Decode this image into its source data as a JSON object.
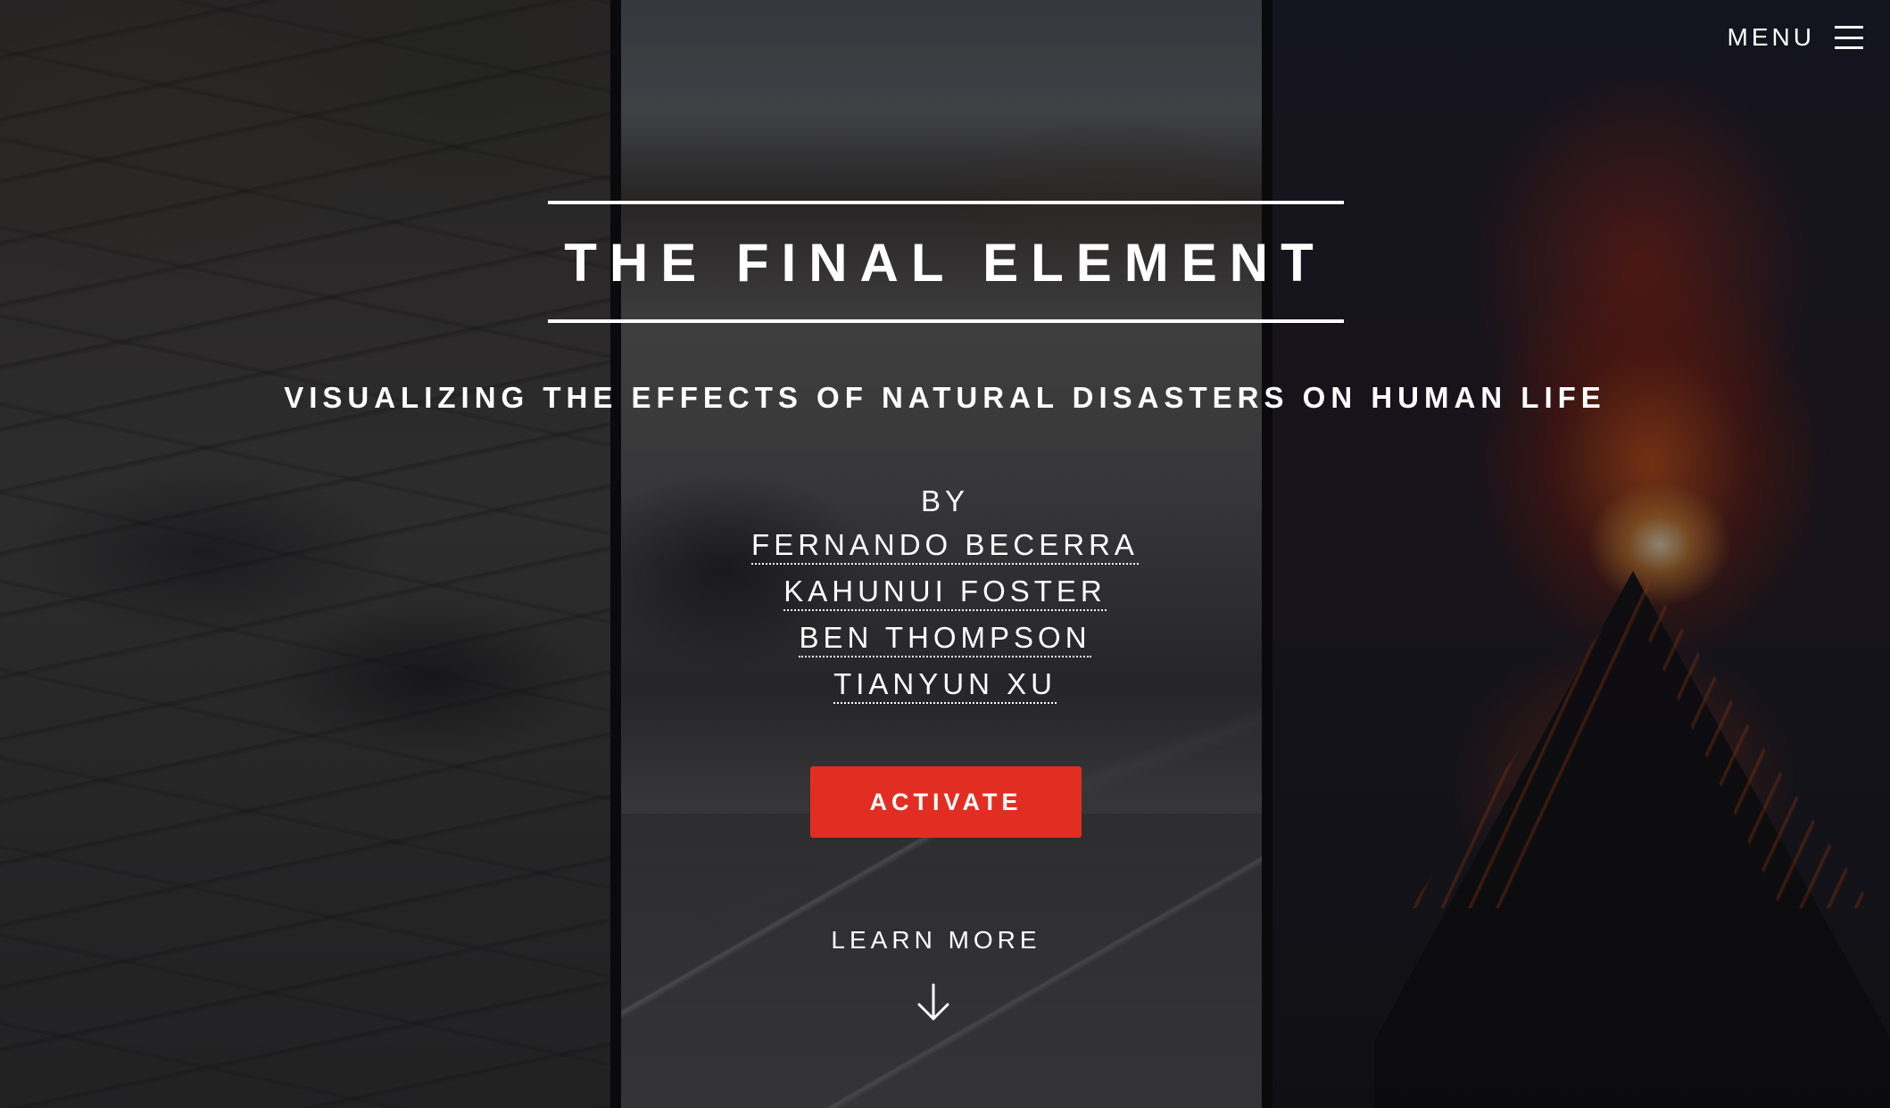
{
  "menu": {
    "label": "MENU",
    "icon": "hamburger-icon"
  },
  "hero": {
    "title": "THE FINAL ELEMENT",
    "subtitle": "VISUALIZING THE EFFECTS OF NATURAL DISASTERS ON HUMAN LIFE",
    "by_label": "BY",
    "authors": [
      "FERNANDO BECERRA",
      "KAHUNUI FOSTER",
      "BEN THOMPSON",
      "TIANYUN XU"
    ],
    "cta_label": "ACTIVATE",
    "learn_more_label": "LEARN MORE",
    "learn_more_icon": "arrow-down-icon"
  },
  "background": {
    "panels": [
      "earthquake-photo",
      "tsunami-photo",
      "volcano-photo"
    ]
  },
  "colors": {
    "accent": "#e22e22",
    "text": "#ffffff"
  }
}
